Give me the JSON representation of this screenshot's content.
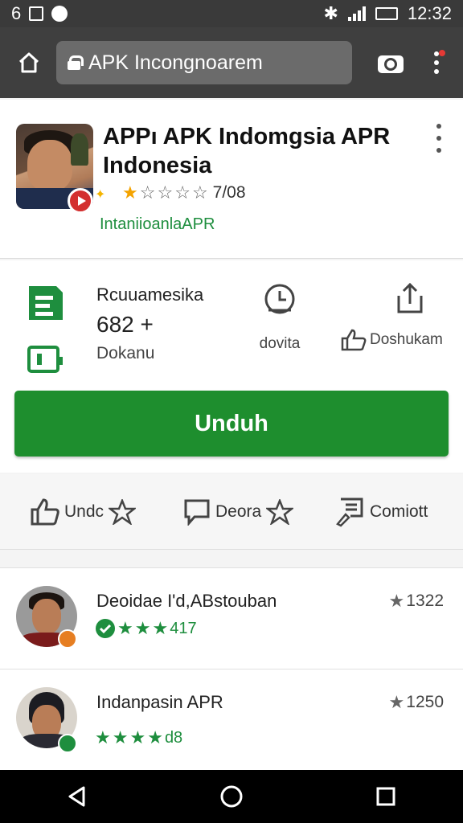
{
  "status_bar": {
    "left_text": "6",
    "time": "12:32"
  },
  "browser": {
    "url": "APK Incongnoarem"
  },
  "app": {
    "title": "APPı APK Indomgsia APR Indonesia",
    "rating": 1,
    "rating_max": 5,
    "rating_count": "7/08",
    "developer": "IntaniioanlaAPR"
  },
  "stats": {
    "title": "Rcuuamesika",
    "count": "682 +",
    "sub": "Dokanu",
    "mid_label": "dovita",
    "right_label": "Doshukam"
  },
  "install_button": {
    "label": "Unduh"
  },
  "actions": [
    {
      "label": "Undc",
      "icon": "thumbs-up-icon"
    },
    {
      "label": "Deora",
      "icon": "comment-icon"
    },
    {
      "label": "Comiott",
      "icon": "edit-icon"
    }
  ],
  "reviews": [
    {
      "name": "Deoidae I'd,ABstouban",
      "stars": 3,
      "count": "417",
      "score": "1322",
      "badge_color": "#e67e22"
    },
    {
      "name": "Indanpasin APR",
      "stars": 4,
      "count": "d8",
      "score": "1250",
      "badge_color": "#1e8e3e"
    }
  ],
  "colors": {
    "accent": "#1e8e2e",
    "star": "#f4a300",
    "developer": "#1e8e3e"
  }
}
